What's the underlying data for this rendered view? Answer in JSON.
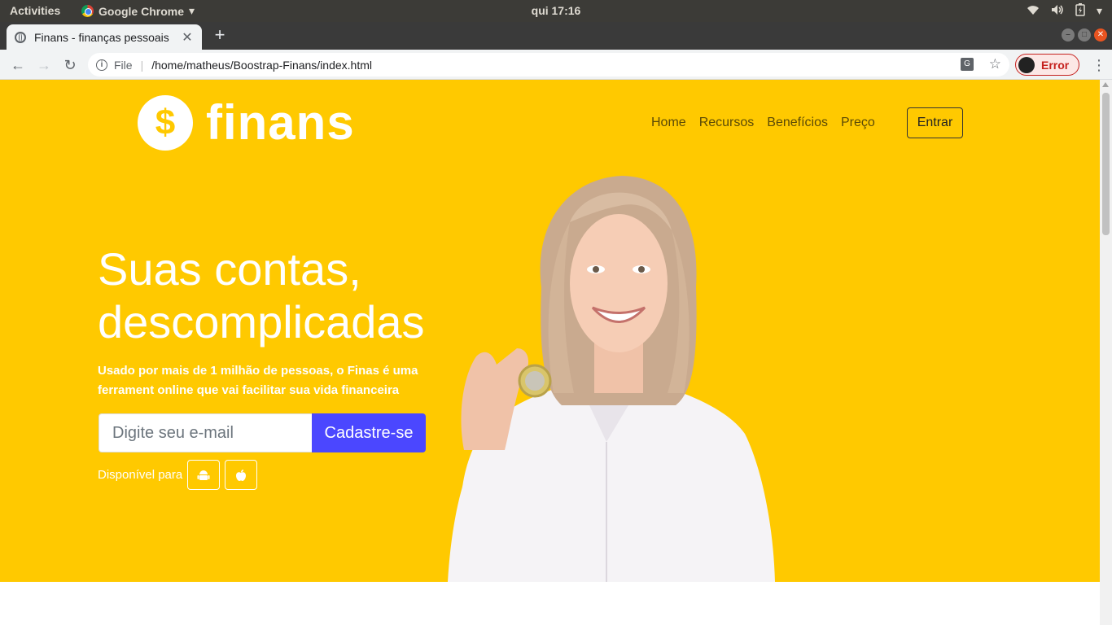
{
  "os": {
    "activities": "Activities",
    "app_name": "Google Chrome",
    "clock": "qui 17:16"
  },
  "browser": {
    "tab_title": "Finans - finanças pessoais",
    "tab_close": "✕",
    "new_tab": "+",
    "address_scheme": "File",
    "address_url": "/home/matheus/Boostrap-Finans/index.html",
    "profile_status": "Error"
  },
  "page": {
    "logo_symbol": "$",
    "logo_text": "finans",
    "nav": [
      "Home",
      "Recursos",
      "Benefícios",
      "Preço"
    ],
    "login_button": "Entrar",
    "headline_line1": "Suas contas,",
    "headline_line2": "descomplicadas",
    "subtext": "Usado por mais de 1 milhão de pessoas, o Finas é uma ferrament online que vai facilitar sua vida financeira",
    "email_placeholder": "Digite seu e-mail",
    "signup_button": "Cadastre-se",
    "available_label": "Disponível para",
    "stores": [
      "android-icon",
      "apple-icon"
    ]
  },
  "colors": {
    "hero_bg": "#ffc900",
    "signup_button": "#4b47ff",
    "text_on_hero": "#ffffff"
  }
}
